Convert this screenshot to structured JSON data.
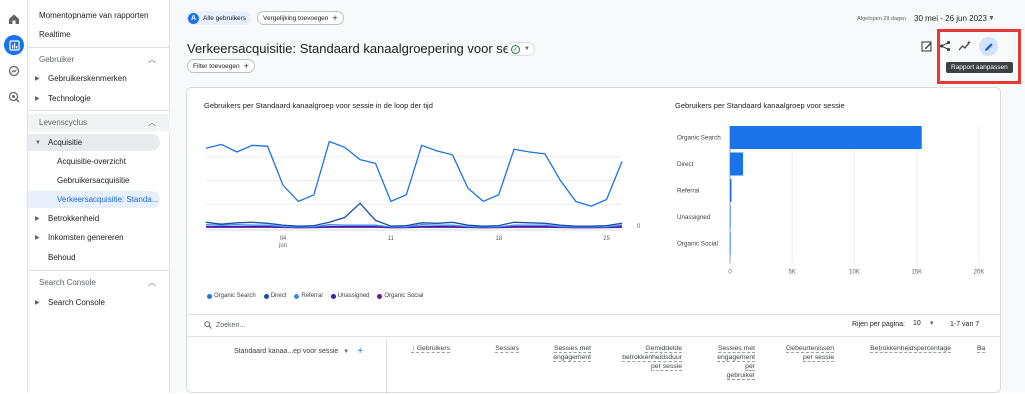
{
  "rail": {
    "icons": [
      "home-icon",
      "reports-icon",
      "explore-icon",
      "advertising-icon"
    ]
  },
  "nav": {
    "top_items": [
      "Momentopname van rapporten",
      "Realtime"
    ],
    "section_user": "Gebruiker",
    "user_items": [
      "Gebruikerskenmerken",
      "Technologie"
    ],
    "section_lifecycle": "Levenscyclus",
    "acquisition": "Acquisitie",
    "acquisition_items": [
      "Acquisitie-overzicht",
      "Gebruikersacquisitie",
      "Verkeersacquisitie: Standa..."
    ],
    "lifecycle_items": [
      "Betrokkenheid",
      "Inkomsten genereren",
      "Behoud"
    ],
    "section_search": "Search Console",
    "search_items": [
      "Search Console"
    ]
  },
  "header": {
    "comparison_chip": "Alle gebruikers",
    "comparison_avatar": "A",
    "add_comparison": "Vergelijking toevoegen",
    "date_label": "Afgelopen 28 dagen",
    "date_range": "30 mei - 26 jun 2023",
    "title": "Verkeersacquisitie: Standaard kanaalgroepering voor sessie",
    "add_filter": "Filter toevoegen",
    "tooltip": "Rapport aanpassen"
  },
  "line_chart": {
    "title": "Gebruikers per Standaard kanaalgroep voor sessie in de loop der tijd",
    "x_ticks": [
      {
        "top": "04",
        "bottom": "jun"
      },
      {
        "top": "11",
        "bottom": ""
      },
      {
        "top": "18",
        "bottom": ""
      },
      {
        "top": "25",
        "bottom": ""
      }
    ],
    "y_tick_zero": "0"
  },
  "bar_chart": {
    "title": "Gebruikers per Standaard kanaalgroep voor sessie",
    "x_ticks": [
      "0",
      "5K",
      "10K",
      "15K",
      "20K"
    ]
  },
  "legend": [
    {
      "name": "Organic Search",
      "color": "#1a73e8"
    },
    {
      "name": "Direct",
      "color": "#174ea6"
    },
    {
      "name": "Referral",
      "color": "#4285f4"
    },
    {
      "name": "Unassigned",
      "color": "#3c1fa8"
    },
    {
      "name": "Organic Social",
      "color": "#6a1b9a"
    }
  ],
  "chart_data": [
    {
      "type": "line",
      "title": "Gebruikers per Standaard kanaalgroep voor sessie in de loop der tijd",
      "x": [
        "30 mei",
        "31 mei",
        "1 jun",
        "2 jun",
        "3 jun",
        "4 jun",
        "5 jun",
        "6 jun",
        "7 jun",
        "8 jun",
        "9 jun",
        "10 jun",
        "11 jun",
        "12 jun",
        "13 jun",
        "14 jun",
        "15 jun",
        "16 jun",
        "17 jun",
        "18 jun",
        "19 jun",
        "20 jun",
        "21 jun",
        "22 jun",
        "23 jun",
        "24 jun",
        "25 jun",
        "26 jun"
      ],
      "ylim": [
        0,
        1000
      ],
      "grid": true,
      "series": [
        {
          "name": "Organic Search",
          "color": "#1a73e8",
          "values": [
            840,
            880,
            800,
            870,
            860,
            450,
            280,
            350,
            910,
            850,
            720,
            680,
            280,
            350,
            870,
            810,
            770,
            420,
            280,
            350,
            830,
            800,
            780,
            500,
            280,
            230,
            300,
            700
          ]
        },
        {
          "name": "Direct",
          "color": "#174ea6",
          "values": [
            60,
            40,
            55,
            60,
            50,
            30,
            20,
            25,
            60,
            110,
            260,
            80,
            20,
            25,
            55,
            50,
            60,
            30,
            20,
            25,
            60,
            55,
            50,
            30,
            20,
            20,
            25,
            50
          ]
        },
        {
          "name": "Referral",
          "color": "#4285f4",
          "values": [
            35,
            30,
            35,
            30,
            30,
            15,
            10,
            12,
            35,
            30,
            30,
            30,
            10,
            12,
            35,
            30,
            30,
            15,
            10,
            12,
            30,
            30,
            30,
            15,
            10,
            10,
            12,
            30
          ]
        },
        {
          "name": "Unassigned",
          "color": "#3c1fa8",
          "values": [
            15,
            15,
            15,
            15,
            15,
            8,
            5,
            6,
            15,
            15,
            15,
            15,
            5,
            6,
            15,
            15,
            15,
            8,
            5,
            6,
            15,
            15,
            15,
            8,
            5,
            5,
            6,
            15
          ]
        },
        {
          "name": "Organic Social",
          "color": "#6a1b9a",
          "values": [
            8,
            8,
            8,
            8,
            8,
            5,
            3,
            4,
            8,
            8,
            8,
            8,
            3,
            4,
            8,
            8,
            8,
            5,
            3,
            4,
            8,
            8,
            8,
            5,
            3,
            3,
            4,
            8
          ]
        }
      ]
    },
    {
      "type": "bar",
      "title": "Gebruikers per Standaard kanaalgroep voor sessie",
      "orientation": "horizontal",
      "categories": [
        "Organic Search",
        "Direct",
        "Referral",
        "Unassigned",
        "Organic Social"
      ],
      "values": [
        15400,
        1050,
        120,
        10,
        5
      ],
      "xlim": [
        0,
        20000
      ],
      "color": "#1a73e8"
    }
  ],
  "table": {
    "search_placeholder": "Zoeken...",
    "rows_per_page_label": "Rijen per pagina:",
    "rows_per_page": "10",
    "range": "1-7 van 7",
    "dimension_header": "Standaard kanaa...ep voor sessie",
    "columns": [
      {
        "label": "↓ Gebruikers",
        "lines": [
          "↓ Gebruikers"
        ]
      },
      {
        "label": "Sessies",
        "lines": [
          "Sessies"
        ]
      },
      {
        "label": "Sessies met engagement",
        "lines": [
          "Sessies met",
          "engagement"
        ]
      },
      {
        "label": "Gemiddelde betrokkenheidsduur per sessie",
        "lines": [
          "Gemiddelde",
          "betrokkenheidsduur",
          "per sessie"
        ]
      },
      {
        "label": "Sessies met engagement per gebruiker",
        "lines": [
          "Sessies met",
          "engagement",
          "per",
          "gebruiker"
        ]
      },
      {
        "label": "Gebeurtenissen per sessie",
        "lines": [
          "Gebeurtenissen",
          "per sessie"
        ]
      },
      {
        "label": "Betrokkenheidspercentage",
        "lines": [
          "Betrokkenheidspercentage"
        ]
      },
      {
        "label": "Ba",
        "lines": [
          "Ba"
        ]
      }
    ]
  }
}
